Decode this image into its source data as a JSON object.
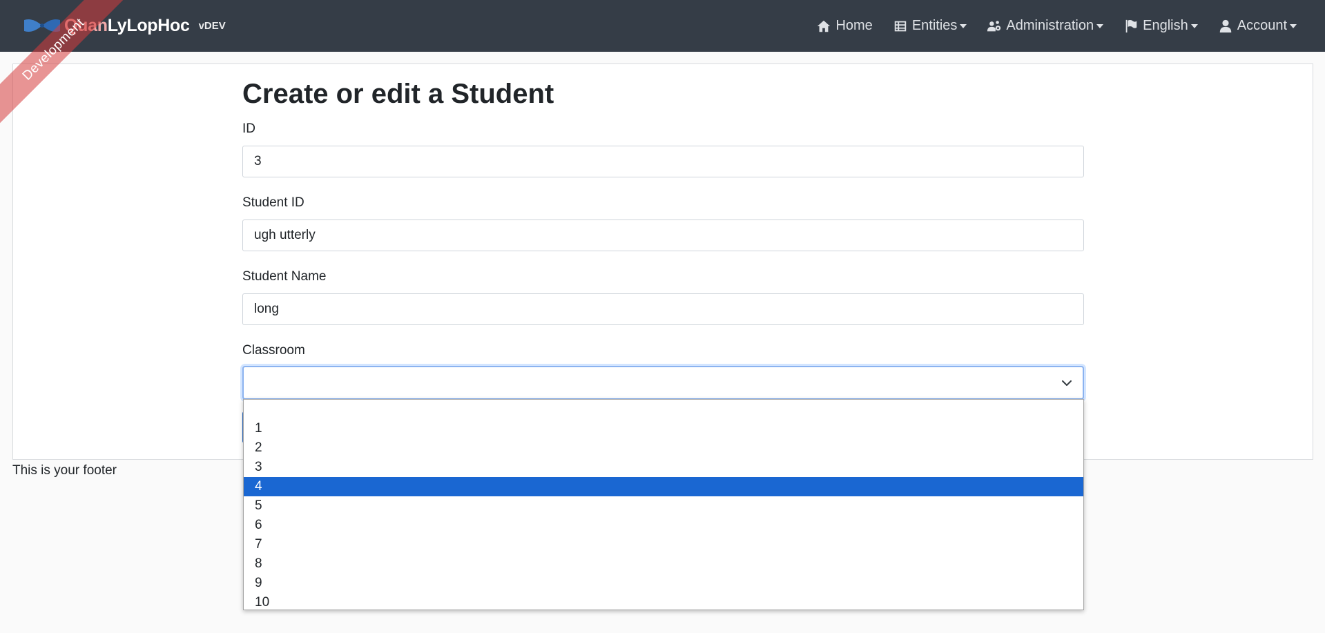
{
  "app": {
    "brand_part1": "Quan",
    "brand_part2": "LyLopHoc",
    "version": "vDEV",
    "ribbon": "Development"
  },
  "nav": {
    "home": "Home",
    "entities": "Entities",
    "administration": "Administration",
    "language": "English",
    "account": "Account"
  },
  "page": {
    "title": "Create or edit a Student"
  },
  "form": {
    "id_label": "ID",
    "id_value": "3",
    "student_id_label": "Student ID",
    "student_id_value": "ugh utterly",
    "student_name_label": "Student Name",
    "student_name_value": "long",
    "classroom_label": "Classroom",
    "classroom_value": ""
  },
  "classroom_options": [
    "",
    "1",
    "2",
    "3",
    "4",
    "5",
    "6",
    "7",
    "8",
    "9",
    "10"
  ],
  "classroom_highlighted": "4",
  "footer": "This is your footer",
  "colors": {
    "navbar": "#353d47",
    "highlight": "#1a67d2",
    "ribbon": "#d63c3c"
  }
}
